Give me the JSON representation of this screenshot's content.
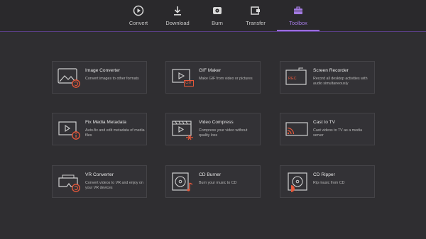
{
  "nav": {
    "items": [
      {
        "label": "Convert",
        "icon": "convert-icon"
      },
      {
        "label": "Download",
        "icon": "download-icon"
      },
      {
        "label": "Burn",
        "icon": "burn-icon"
      },
      {
        "label": "Transfer",
        "icon": "transfer-icon"
      },
      {
        "label": "Toolbox",
        "icon": "toolbox-icon"
      }
    ],
    "active": "Toolbox"
  },
  "tools": [
    {
      "title": "Image Converter",
      "desc": "Convert images to other formats",
      "icon": "image-converter-icon"
    },
    {
      "title": "GIF Maker",
      "desc": "Make GIF from video or pictures",
      "icon": "gif-maker-icon"
    },
    {
      "title": "Screen Recorder",
      "desc": "Record all desktop activities with audio simultaneously",
      "icon": "screen-recorder-icon"
    },
    {
      "title": "Fix Media Metadata",
      "desc": "Auto-fix and edit metadata of media files",
      "icon": "metadata-icon"
    },
    {
      "title": "Video Compress",
      "desc": "Compress your video without quality loss",
      "icon": "video-compress-icon"
    },
    {
      "title": "Cast to TV",
      "desc": "Cast videos to TV as a media server",
      "icon": "cast-tv-icon"
    },
    {
      "title": "VR Converter",
      "desc": "Convert videos to VR and enjoy on your VR devices",
      "icon": "vr-converter-icon"
    },
    {
      "title": "CD Burner",
      "desc": "Burn your music to CD",
      "icon": "cd-burner-icon"
    },
    {
      "title": "CD Ripper",
      "desc": "Rip music from CD",
      "icon": "cd-ripper-icon"
    }
  ],
  "badges": {
    "gif": "GIF",
    "rec": "REC"
  },
  "colors": {
    "accent": "#9b6ce0",
    "orange": "#e8583a",
    "background": "#2f2e31"
  }
}
